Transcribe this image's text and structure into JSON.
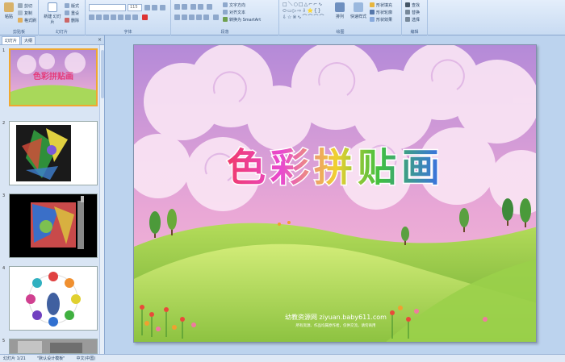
{
  "ribbon": {
    "clipboard": {
      "label": "剪贴板",
      "paste": "粘贴",
      "cut": "剪切",
      "copy": "复制",
      "format_painter": "格式刷"
    },
    "slides": {
      "label": "幻灯片",
      "new_slide": "新建 幻灯片",
      "layout": "版式",
      "reset": "重设",
      "delete": "删除"
    },
    "font": {
      "label": "字体",
      "font_size": "115"
    },
    "paragraph": {
      "label": "段落",
      "text_direction": "文字方向",
      "align_text": "对齐文本",
      "smartart": "转换为 SmartArt"
    },
    "drawing": {
      "label": "绘图",
      "arrange": "排列",
      "quick_styles": "快速样式",
      "shape_fill": "形状填充",
      "shape_outline": "形状轮廓",
      "shape_effects": "形状效果"
    },
    "editing": {
      "label": "编辑",
      "find": "查找",
      "replace": "替换",
      "select": "选择"
    }
  },
  "left_pane": {
    "tabs": [
      "幻灯片",
      "大纲"
    ],
    "close": "×",
    "slides": [
      {
        "num": "1",
        "title": "色彩拼贴画"
      },
      {
        "num": "2"
      },
      {
        "num": "3"
      },
      {
        "num": "4"
      },
      {
        "num": "5"
      }
    ]
  },
  "slide": {
    "title": "色彩拼贴画",
    "watermark_main": "幼教资源网 ziyuan.baby611.com",
    "watermark_sub": "所有资源、作品均属原作者，仅供交流，请勿商用"
  },
  "status": {
    "slide_pos": "幻灯片 1/21",
    "theme": "\"默认设计模板\"",
    "language": "中文(中国)"
  },
  "colors": {
    "sky_top": "#b78ad4",
    "sky_bottom": "#f2b4d4",
    "hill_light": "#c6e86a",
    "hill_dark": "#7fbd3c",
    "ribbon_bg": "#dbe7f7"
  }
}
